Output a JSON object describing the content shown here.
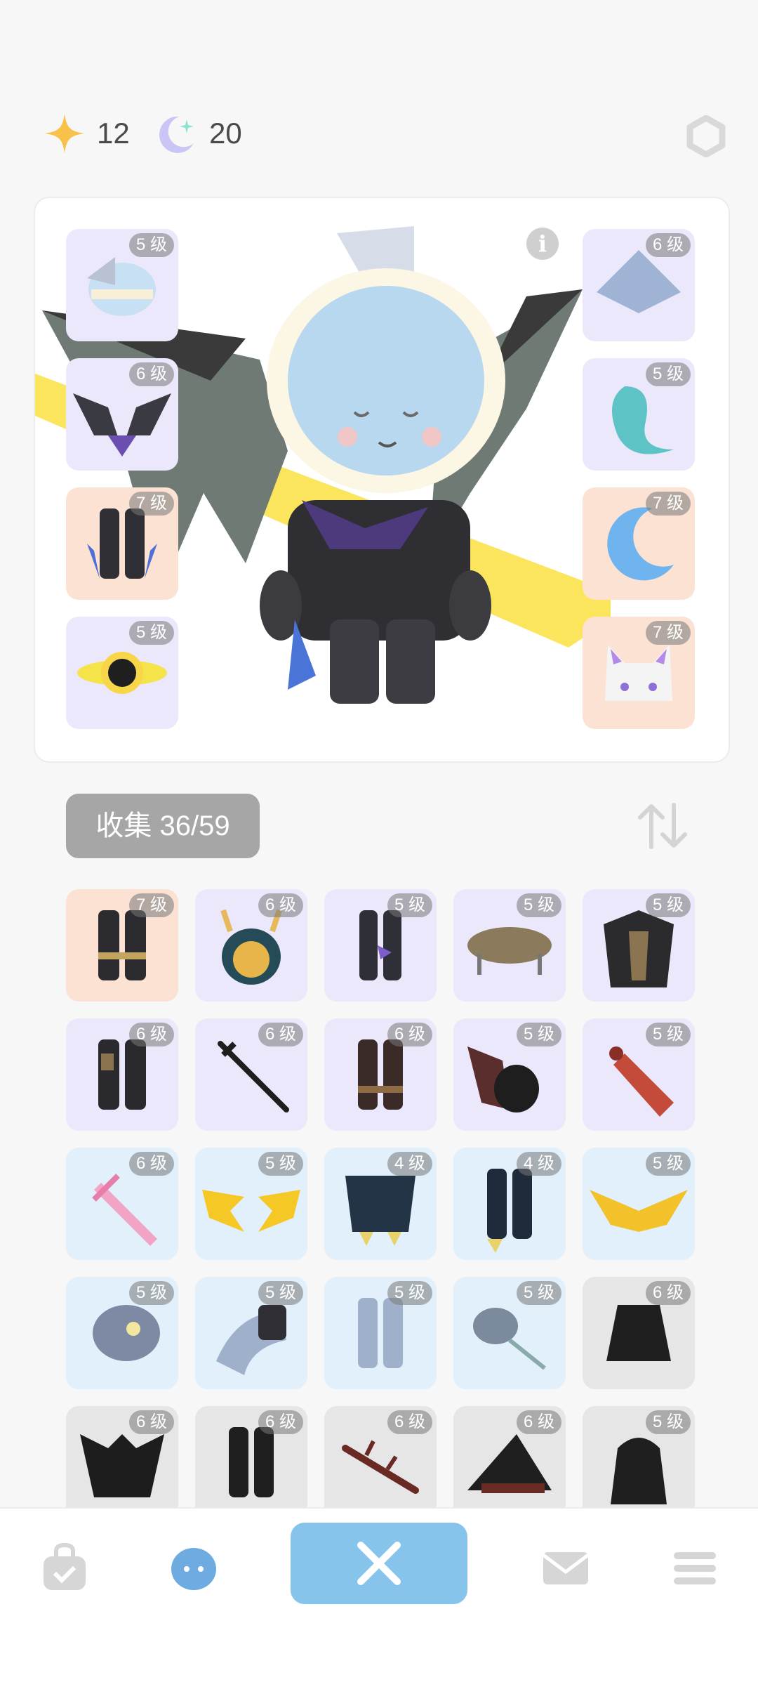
{
  "currency": {
    "star_count": "12",
    "moon_count": "20",
    "star_icon": "star-sparkle-icon",
    "moon_icon": "crescent-moon-icon",
    "settings_icon": "hexagon-settings-icon"
  },
  "preview": {
    "info_label": "i",
    "equipped": [
      {
        "level": "5 级",
        "item": "helmet-icon"
      },
      {
        "level": "6 级",
        "item": "bat-armor-icon"
      },
      {
        "level": "7 级",
        "item": "boots-icon"
      },
      {
        "level": "5 级",
        "item": "black-hole-icon"
      },
      {
        "level": "6 级",
        "item": "spinning-top-icon"
      },
      {
        "level": "5 级",
        "item": "knot-icon"
      },
      {
        "level": "7 级",
        "item": "moon-icon"
      },
      {
        "level": "7 级",
        "item": "cat-mask-icon"
      }
    ]
  },
  "collection": {
    "label": "收集 36/59",
    "sort_icon": "sort-arrows-icon",
    "items": [
      {
        "level": "7 级",
        "item": "gold-boots-icon"
      },
      {
        "level": "6 级",
        "item": "antler-hood-icon"
      },
      {
        "level": "5 级",
        "item": "purple-leggings-icon"
      },
      {
        "level": "5 级",
        "item": "table-hat-icon"
      },
      {
        "level": "5 级",
        "item": "dark-coat-icon"
      },
      {
        "level": "6 级",
        "item": "patched-pants-icon"
      },
      {
        "level": "6 级",
        "item": "katana-icon"
      },
      {
        "level": "6 级",
        "item": "brown-boots-icon"
      },
      {
        "level": "5 级",
        "item": "bat-helmet-icon"
      },
      {
        "level": "5 级",
        "item": "flame-sword-icon"
      },
      {
        "level": "6 级",
        "item": "pink-sword-icon"
      },
      {
        "level": "5 级",
        "item": "lightning-wings-icon"
      },
      {
        "level": "4 级",
        "item": "claw-top-icon"
      },
      {
        "level": "4 级",
        "item": "claw-pants-icon"
      },
      {
        "level": "5 级",
        "item": "golden-wings-icon"
      },
      {
        "level": "5 级",
        "item": "fish-helmet-icon"
      },
      {
        "level": "5 级",
        "item": "tentacle-arm-icon"
      },
      {
        "level": "5 级",
        "item": "gray-pants-icon"
      },
      {
        "level": "5 级",
        "item": "fish-bone-icon"
      },
      {
        "level": "6 级",
        "item": "black-hood-icon"
      },
      {
        "level": "6 级",
        "item": "demon-body-icon"
      },
      {
        "level": "6 级",
        "item": "black-boots-icon"
      },
      {
        "level": "6 级",
        "item": "red-branch-icon"
      },
      {
        "level": "6 级",
        "item": "witch-hat-icon"
      },
      {
        "level": "5 级",
        "item": "black-cloak-icon"
      }
    ]
  },
  "nav": {
    "items": [
      "bag-icon",
      "character-icon",
      "crossed-swords-icon",
      "mail-icon",
      "menu-icon"
    ]
  },
  "colors": {
    "accent": "#86c4ec",
    "purple_tile": "#ece8fb",
    "peach_tile": "#fbe2d3",
    "blue_tile": "#e1f0fb",
    "gray_tile": "#e6e6e6"
  }
}
